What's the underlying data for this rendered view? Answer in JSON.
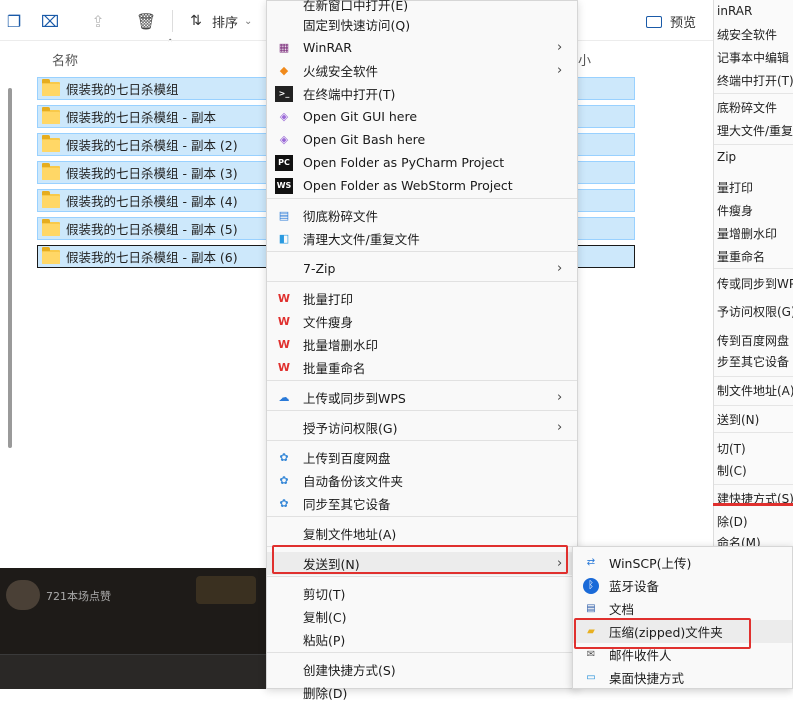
{
  "toolbar": {
    "sort_label": "排序",
    "preview_label": "预览"
  },
  "explorer": {
    "column_name": "名称",
    "column_size": "小",
    "files": [
      "假装我的七日杀模组",
      "假装我的七日杀模组 - 副本",
      "假装我的七日杀模组 - 副本 (2)",
      "假装我的七日杀模组 - 副本 (3)",
      "假装我的七日杀模组 - 副本 (4)",
      "假装我的七日杀模组 - 副本 (5)",
      "假装我的七日杀模组 - 副本 (6)"
    ],
    "background_text": "721本场点赞"
  },
  "context_menu": {
    "items": [
      {
        "label": "在新窗口中打开(E)"
      },
      {
        "label": "固定到快速访问(Q)"
      },
      {
        "label": "WinRAR"
      },
      {
        "label": "火绒安全软件"
      },
      {
        "label": "在终端中打开(T)"
      },
      {
        "label": "Open Git GUI here"
      },
      {
        "label": "Open Git Bash here"
      },
      {
        "label": "Open Folder as PyCharm Project"
      },
      {
        "label": "Open Folder as WebStorm Project"
      },
      {
        "label": "彻底粉碎文件"
      },
      {
        "label": "清理大文件/重复文件"
      },
      {
        "label": "7-Zip"
      },
      {
        "label": "批量打印"
      },
      {
        "label": "文件瘦身"
      },
      {
        "label": "批量增删水印"
      },
      {
        "label": "批量重命名"
      },
      {
        "label": "上传或同步到WPS"
      },
      {
        "label": "授予访问权限(G)"
      },
      {
        "label": "上传到百度网盘"
      },
      {
        "label": "自动备份该文件夹"
      },
      {
        "label": "同步至其它设备"
      },
      {
        "label": "复制文件地址(A)"
      },
      {
        "label": "发送到(N)"
      },
      {
        "label": "剪切(T)"
      },
      {
        "label": "复制(C)"
      },
      {
        "label": "粘贴(P)"
      },
      {
        "label": "创建快捷方式(S)"
      },
      {
        "label": "删除(D)"
      }
    ]
  },
  "send_to_menu": {
    "items": [
      {
        "label": "WinSCP(上传)"
      },
      {
        "label": "蓝牙设备"
      },
      {
        "label": "文档"
      },
      {
        "label": "压缩(zipped)文件夹"
      },
      {
        "label": "邮件收件人"
      },
      {
        "label": "桌面快捷方式"
      }
    ]
  },
  "right_window": {
    "items": [
      "inRAR",
      "绒安全软件",
      "记事本中编辑",
      "终端中打开(T)",
      "底粉碎文件",
      "理大文件/重复",
      "Zip",
      "量打印",
      "件瘦身",
      "量增删水印",
      "量重命名",
      "传或同步到WP",
      "予访问权限(G)",
      "传到百度网盘",
      "步至其它设备",
      "制文件地址(A)",
      "送到(N)",
      "切(T)",
      "制(C)",
      "建快捷方式(S)",
      "除(D)",
      "命名(M)"
    ]
  },
  "colors": {
    "highlight": "#e0302e",
    "selection": "#cde8fb",
    "selection_border": "#99d1ff"
  }
}
